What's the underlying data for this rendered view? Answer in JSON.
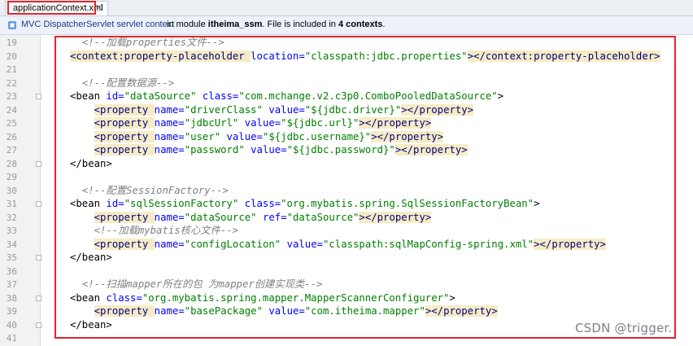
{
  "tab": {
    "label": "applicationContext.xml",
    "close": "×"
  },
  "infobar": {
    "context": "MVC DispatcherServlet servlet context",
    "in_module": "in module",
    "module": "itheima_ssm",
    "file_included": ". File is included in",
    "count": "4 contexts",
    "end": "."
  },
  "lines": [
    {
      "n": "19",
      "parts": [
        [
          "  ",
          ""
        ],
        [
          "<!--加载properties文件-->",
          "cm"
        ]
      ]
    },
    {
      "n": "20",
      "parts": [
        [
          "<context:property-placeholder ",
          "tg"
        ],
        [
          "location=",
          "an"
        ],
        [
          "\"classpath:jdbc.properties\"",
          "av"
        ],
        [
          "></context:property-placeholder>",
          "tg"
        ]
      ]
    },
    {
      "n": "21",
      "parts": []
    },
    {
      "n": "22",
      "parts": [
        [
          "  ",
          ""
        ],
        [
          "<!--配置数据源-->",
          "cm"
        ]
      ]
    },
    {
      "n": "23",
      "parts": [
        [
          "<bean ",
          "bk"
        ],
        [
          "id=",
          "an"
        ],
        [
          "\"dataSource\"",
          "av"
        ],
        [
          " class=",
          "an"
        ],
        [
          "\"com.mchange.v2.c3p0.ComboPooledDataSource\"",
          "av"
        ],
        [
          ">",
          "bk"
        ]
      ]
    },
    {
      "n": "24",
      "parts": [
        [
          "    ",
          ""
        ],
        [
          "<property ",
          "tg"
        ],
        [
          "name=",
          "an"
        ],
        [
          "\"driverClass\"",
          "av"
        ],
        [
          " value=",
          "an"
        ],
        [
          "\"${jdbc.driver}\"",
          "av"
        ],
        [
          "></property>",
          "tg"
        ]
      ]
    },
    {
      "n": "25",
      "parts": [
        [
          "    ",
          ""
        ],
        [
          "<property ",
          "tg"
        ],
        [
          "name=",
          "an"
        ],
        [
          "\"jdbcUrl\"",
          "av"
        ],
        [
          " value=",
          "an"
        ],
        [
          "\"${jdbc.url}\"",
          "av"
        ],
        [
          "></property>",
          "tg"
        ]
      ]
    },
    {
      "n": "26",
      "parts": [
        [
          "    ",
          ""
        ],
        [
          "<property ",
          "tg"
        ],
        [
          "name=",
          "an"
        ],
        [
          "\"user\"",
          "av"
        ],
        [
          " value=",
          "an"
        ],
        [
          "\"${jdbc.username}\"",
          "av"
        ],
        [
          "></property>",
          "tg"
        ]
      ]
    },
    {
      "n": "27",
      "parts": [
        [
          "    ",
          ""
        ],
        [
          "<property ",
          "tg"
        ],
        [
          "name=",
          "an"
        ],
        [
          "\"password\"",
          "av"
        ],
        [
          " value=",
          "an"
        ],
        [
          "\"${jdbc.password}\"",
          "av"
        ],
        [
          "></property>",
          "tg"
        ]
      ]
    },
    {
      "n": "28",
      "parts": [
        [
          "</bean>",
          "bk"
        ]
      ]
    },
    {
      "n": "29",
      "parts": []
    },
    {
      "n": "30",
      "parts": [
        [
          "  ",
          ""
        ],
        [
          "<!--配置SessionFactory-->",
          "cm"
        ]
      ]
    },
    {
      "n": "31",
      "parts": [
        [
          "<bean ",
          "bk"
        ],
        [
          "id=",
          "an"
        ],
        [
          "\"sqlSessionFactory\"",
          "av"
        ],
        [
          " class=",
          "an"
        ],
        [
          "\"org.mybatis.spring.SqlSessionFactoryBean\"",
          "av"
        ],
        [
          ">",
          "bk"
        ]
      ]
    },
    {
      "n": "32",
      "parts": [
        [
          "    ",
          ""
        ],
        [
          "<property ",
          "tg"
        ],
        [
          "name=",
          "an"
        ],
        [
          "\"dataSource\"",
          "av"
        ],
        [
          " ref=",
          "an"
        ],
        [
          "\"dataSource\"",
          "av"
        ],
        [
          "></property>",
          "tg"
        ]
      ]
    },
    {
      "n": "33",
      "parts": [
        [
          "    ",
          ""
        ],
        [
          "<!--加载mybatis核心文件-->",
          "cm"
        ]
      ]
    },
    {
      "n": "34",
      "parts": [
        [
          "    ",
          ""
        ],
        [
          "<property ",
          "tg"
        ],
        [
          "name=",
          "an"
        ],
        [
          "\"configLocation\"",
          "av"
        ],
        [
          " value=",
          "an"
        ],
        [
          "\"classpath:sqlMapConfig-spring.xml\"",
          "av"
        ],
        [
          "></property>",
          "tg"
        ]
      ]
    },
    {
      "n": "35",
      "parts": [
        [
          "</bean>",
          "bk"
        ]
      ]
    },
    {
      "n": "36",
      "parts": []
    },
    {
      "n": "37",
      "parts": [
        [
          "  ",
          ""
        ],
        [
          "<!--扫描mapper所在的包 为mapper创建实现类-->",
          "cm"
        ]
      ]
    },
    {
      "n": "38",
      "parts": [
        [
          "<bean ",
          "bk"
        ],
        [
          "class=",
          "an"
        ],
        [
          "\"org.mybatis.spring.mapper.MapperScannerConfigurer\"",
          "av"
        ],
        [
          ">",
          "bk"
        ]
      ]
    },
    {
      "n": "39",
      "parts": [
        [
          "    ",
          ""
        ],
        [
          "<property ",
          "tg"
        ],
        [
          "name=",
          "an"
        ],
        [
          "\"basePackage\"",
          "av"
        ],
        [
          " value=",
          "an"
        ],
        [
          "\"com.itheima.mapper\"",
          "av"
        ],
        [
          "></property>",
          "tg"
        ]
      ]
    },
    {
      "n": "40",
      "parts": [
        [
          "</bean>",
          "bk"
        ]
      ]
    },
    {
      "n": "41",
      "parts": []
    }
  ],
  "watermark": "CSDN @trigger.",
  "colors": {
    "highlight": "#e0262c",
    "tag_bg": "#f6ecc4",
    "attr_name": "#0000ff",
    "attr_value": "#008000",
    "comment": "#808080"
  }
}
